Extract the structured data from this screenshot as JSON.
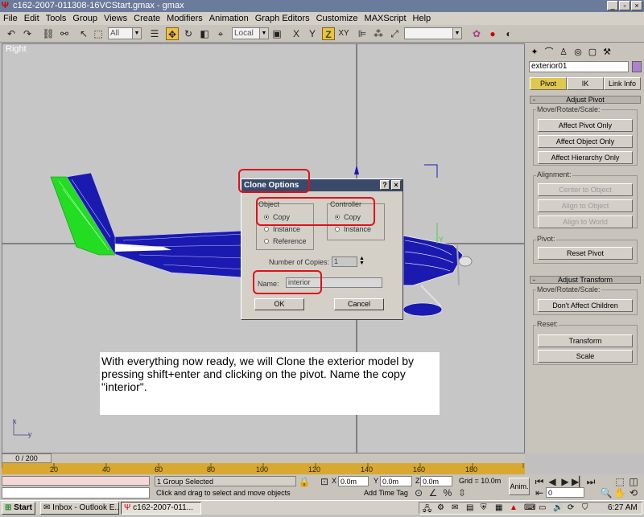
{
  "window": {
    "title": "c162-2007-011308-16VCStart.gmax - gmax"
  },
  "menu": [
    "File",
    "Edit",
    "Tools",
    "Group",
    "Views",
    "Create",
    "Modifiers",
    "Animation",
    "Graph Editors",
    "Customize",
    "MAXScript",
    "Help"
  ],
  "toolbar": {
    "selection_filter": "All",
    "coord_system": "Local",
    "constraint_x": "X",
    "constraint_y": "Y",
    "constraint_z": "Z",
    "constraint_xy": "XY"
  },
  "viewport": {
    "label": "Right",
    "axis_x": "x",
    "axis_y": "y",
    "gizmo_y": "Y"
  },
  "command_panel": {
    "object_name": "exterior01",
    "tabs": [
      "Pivot",
      "IK",
      "Link Info"
    ],
    "adjust_pivot": {
      "rollout_title": "Adjust Pivot",
      "move_rotate_scale_label": "Move/Rotate/Scale:",
      "buttons": [
        "Affect Pivot Only",
        "Affect Object Only",
        "Affect Hierarchy Only"
      ],
      "alignment_label": "Alignment:",
      "alignment_buttons": [
        "Center to Object",
        "Align to Object",
        "Align to World"
      ],
      "pivot_label": "Pivot:",
      "reset_pivot": "Reset Pivot"
    },
    "adjust_transform": {
      "rollout_title": "Adjust Transform",
      "move_rotate_scale_label": "Move/Rotate/Scale:",
      "dont_affect_children": "Don't Affect Children",
      "reset_label": "Reset:",
      "transform": "Transform",
      "scale": "Scale"
    }
  },
  "dialog": {
    "title": "Clone Options",
    "help_btn": "?",
    "close_btn": "×",
    "object_group": "Object",
    "object_options": [
      "Copy",
      "Instance",
      "Reference"
    ],
    "controller_group": "Controller",
    "controller_options": [
      "Copy",
      "Instance"
    ],
    "copies_label": "Number of Copies:",
    "copies_value": "1",
    "name_label": "Name:",
    "name_value": "interior",
    "ok": "OK",
    "cancel": "Cancel"
  },
  "callout": {
    "text": "With everything now ready, we will Clone the exterior model by pressing shift+enter and clicking on the pivot. Name the copy \"interior\"."
  },
  "timeline": {
    "frame_counter": "0 / 200",
    "ticks": [
      "20",
      "40",
      "60",
      "80",
      "100",
      "120",
      "140",
      "160",
      "180"
    ]
  },
  "status": {
    "selection": "1 Group Selected",
    "prompt": "Click and drag to select and move objects",
    "x_label": "X",
    "y_label": "Y",
    "z_label": "Z",
    "x_value": "0.0m",
    "y_value": "0.0m",
    "z_value": "0.0m",
    "grid": "Grid = 10.0m",
    "add_time_tag": "Add Time Tag",
    "anim": "Anim.",
    "frame_field": "0"
  },
  "taskbar": {
    "start": "Start",
    "tasks": [
      "Inbox - Outlook E...",
      "c162-2007-011..."
    ],
    "clock": "6:27 AM"
  }
}
